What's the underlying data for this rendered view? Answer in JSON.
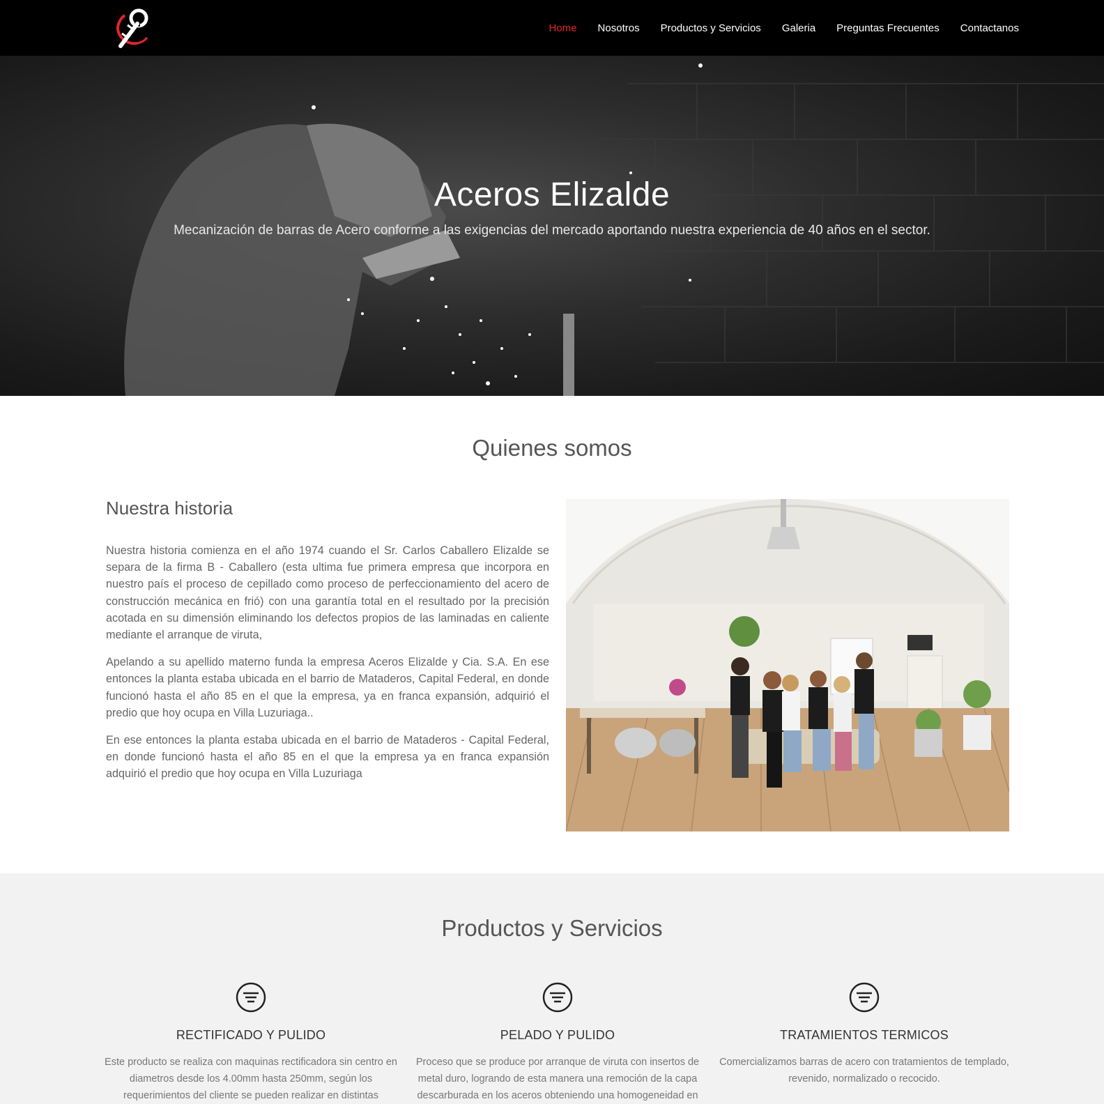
{
  "nav": {
    "items": [
      "Home",
      "Nosotros",
      "Productos y Servicios",
      "Galeria",
      "Preguntas Frecuentes",
      "Contactanos"
    ],
    "active": "Home"
  },
  "hero": {
    "title": "Aceros Elizalde",
    "subtitle": "Mecanización de barras de Acero conforme a las exigencias del mercado aportando nuestra experiencia de 40 años en el sector."
  },
  "about": {
    "title": "Quienes somos",
    "history_title": "Nuestra historia",
    "paragraphs": [
      "Nuestra historia comienza en el año 1974 cuando el Sr. Carlos Caballero Elizalde se separa de la firma B - Caballero (esta ultima fue primera empresa que incorpora en nuestro país el proceso de cepillado como proceso de perfeccionamiento del acero de construcción mecánica en frió) con una garantía total en el resultado por la precisión acotada en su dimensión eliminando los defectos propios de las laminadas en caliente mediante el arranque de viruta,",
      "Apelando a su apellido materno funda la empresa Aceros Elizalde y Cia. S.A. En ese entonces la planta estaba ubicada en el barrio de Mataderos, Capital Federal, en donde funcionó hasta el año 85 en el que la empresa, ya en franca expansión, adquirió el predio que hoy ocupa en Villa Luzuriaga..",
      "En ese entonces la planta estaba ubicada en el barrio de Mataderos - Capital Federal, en donde funcionó hasta el año 85 en el que la empresa ya en franca expansión adquirió el predio que hoy ocupa en Villa Luzuriaga"
    ]
  },
  "products": {
    "title": "Productos y Servicios",
    "cards": [
      {
        "icon": "filter-circle-icon",
        "title": "RECTIFICADO Y PULIDO",
        "text": "Este producto se realiza con maquinas rectificadora sin centro en diametros desde los 4.00mm hasta 250mm, según los requerimientos del cliente se pueden realizar en distintas"
      },
      {
        "icon": "filter-circle-icon",
        "title": "PELADO Y PULIDO",
        "text": "Proceso que se produce por arranque de viruta con insertos de metal duro, logrando de esta manera una remoción de la capa descarburada en los aceros obteniendo una homogeneidad en"
      },
      {
        "icon": "filter-circle-icon",
        "title": "TRATAMIENTOS TERMICOS",
        "text": "Comercializamos barras de acero con tratamientos de templado, revenido, normalizado o recocido."
      }
    ]
  },
  "colors": {
    "header_bg": "#000000",
    "nav_active": "#e0262b",
    "products_bg": "#f1f2f1"
  }
}
